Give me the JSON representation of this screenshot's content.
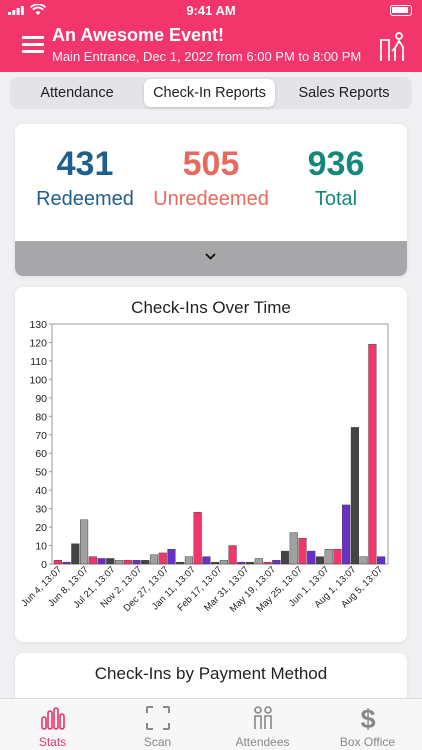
{
  "status_bar": {
    "time": "9:41 AM"
  },
  "header": {
    "title": "An Awesome Event!",
    "subtitle": "Main Entrance, Dec  1, 2022 from 6:00 PM to 8:00 PM"
  },
  "segments": [
    {
      "label": "Attendance",
      "active": false
    },
    {
      "label": "Check-In Reports",
      "active": true
    },
    {
      "label": "Sales Reports",
      "active": false
    }
  ],
  "summary": {
    "redeemed": {
      "value": "431",
      "label": "Redeemed",
      "color": "#1f5f8b"
    },
    "unredeemed": {
      "value": "505",
      "label": "Unredeemed",
      "color": "#e86a5c"
    },
    "total": {
      "value": "936",
      "label": "Total",
      "color": "#13897a"
    }
  },
  "checkins_chart_title": "Check-Ins Over Time",
  "payment_chart_title": "Check-Ins by Payment Method",
  "chart_data": {
    "type": "bar",
    "title": "Check-Ins Over Time",
    "xlabel": "",
    "ylabel": "",
    "ylim": [
      0,
      130
    ],
    "yticks": [
      0,
      10,
      20,
      30,
      40,
      50,
      60,
      70,
      80,
      90,
      100,
      110,
      120,
      130
    ],
    "grid": false,
    "x_tick_labels": [
      "Jun 4, 13:07",
      "Jun 8, 13:07",
      "Jul 21, 13:07",
      "Nov 2, 13:07",
      "Dec 27, 13:07",
      "Jan 11, 13:07",
      "Feb 17, 13:07",
      "Mar 31, 13:07",
      "May 19, 13:07",
      "May 25, 13:07",
      "Jun 1, 13:07",
      "Aug 1, 13:07",
      "Aug 5, 13:07"
    ],
    "bars": [
      {
        "value": 2,
        "color": "#f2366c"
      },
      {
        "value": 1,
        "color": "#6a2fc4"
      },
      {
        "value": 11,
        "color": "#444444"
      },
      {
        "value": 24,
        "color": "#a0a0a0"
      },
      {
        "value": 4,
        "color": "#f2366c"
      },
      {
        "value": 3,
        "color": "#6a2fc4"
      },
      {
        "value": 3,
        "color": "#444444"
      },
      {
        "value": 2,
        "color": "#a0a0a0"
      },
      {
        "value": 2,
        "color": "#f2366c"
      },
      {
        "value": 2,
        "color": "#6a2fc4"
      },
      {
        "value": 2,
        "color": "#444444"
      },
      {
        "value": 5,
        "color": "#a0a0a0"
      },
      {
        "value": 6,
        "color": "#f2366c"
      },
      {
        "value": 8,
        "color": "#6a2fc4"
      },
      {
        "value": 1,
        "color": "#444444"
      },
      {
        "value": 4,
        "color": "#a0a0a0"
      },
      {
        "value": 28,
        "color": "#f2366c"
      },
      {
        "value": 4,
        "color": "#6a2fc4"
      },
      {
        "value": 1,
        "color": "#444444"
      },
      {
        "value": 2,
        "color": "#a0a0a0"
      },
      {
        "value": 10,
        "color": "#f2366c"
      },
      {
        "value": 1,
        "color": "#6a2fc4"
      },
      {
        "value": 1,
        "color": "#444444"
      },
      {
        "value": 3,
        "color": "#a0a0a0"
      },
      {
        "value": 1,
        "color": "#f2366c"
      },
      {
        "value": 2,
        "color": "#6a2fc4"
      },
      {
        "value": 7,
        "color": "#444444"
      },
      {
        "value": 17,
        "color": "#a0a0a0"
      },
      {
        "value": 14,
        "color": "#f2366c"
      },
      {
        "value": 7,
        "color": "#6a2fc4"
      },
      {
        "value": 4,
        "color": "#444444"
      },
      {
        "value": 8,
        "color": "#a0a0a0"
      },
      {
        "value": 8,
        "color": "#f2366c"
      },
      {
        "value": 32,
        "color": "#6a2fc4"
      },
      {
        "value": 74,
        "color": "#444444"
      },
      {
        "value": 4,
        "color": "#a0a0a0"
      },
      {
        "value": 119,
        "color": "#f2366c"
      },
      {
        "value": 4,
        "color": "#6a2fc4"
      }
    ]
  },
  "tabbar": [
    {
      "label": "Stats",
      "icon": "stats-icon",
      "active": true
    },
    {
      "label": "Scan",
      "icon": "scan-icon",
      "active": false
    },
    {
      "label": "Attendees",
      "icon": "attendees-icon",
      "active": false
    },
    {
      "label": "Box Office",
      "icon": "dollar-icon",
      "active": false
    }
  ],
  "colors": {
    "brand": "#f2366c",
    "expand_bar": "#a7a7aa"
  }
}
